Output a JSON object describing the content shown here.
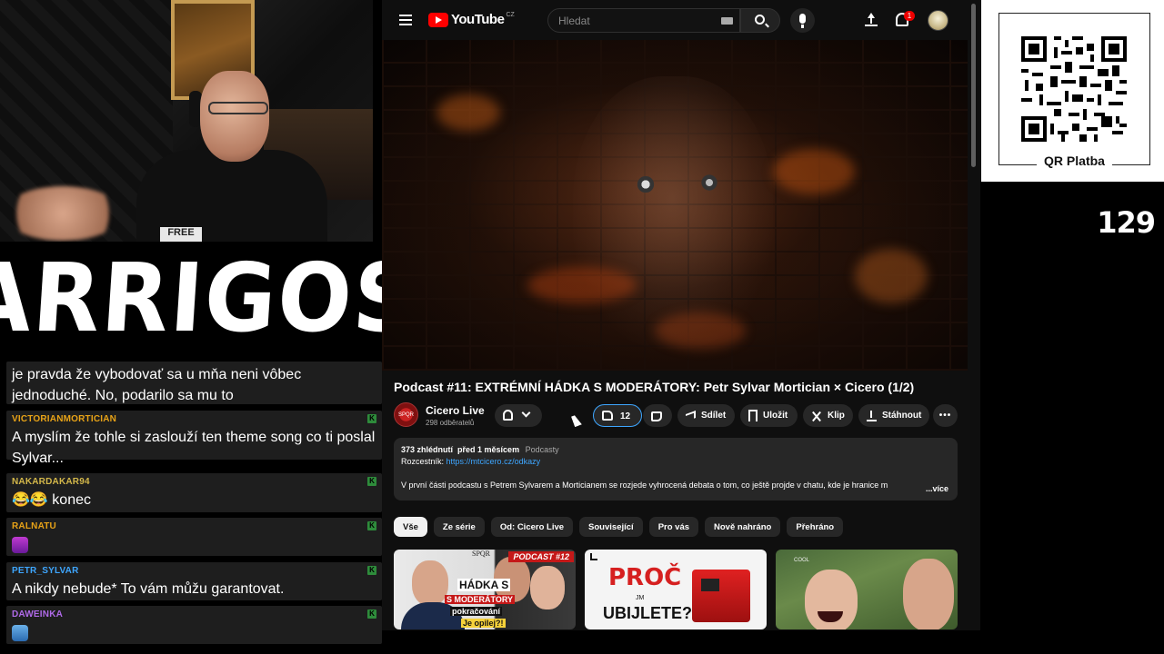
{
  "overlay": {
    "logo_text": "ARRIGOS",
    "viewer_count": "129",
    "qr_label": "QR Platba"
  },
  "chat": {
    "messages": [
      {
        "user": "",
        "text": "je pravda že vybodovať sa u mňa neni vôbec jednoduché. No, podarilo sa mu to",
        "user_color": "#ffffff"
      },
      {
        "user": "VICTORIANMORTICIAN",
        "text": "A myslím že tohle si zaslouží ten theme song co ti poslal Sylvar...",
        "user_color": "#e8a317"
      },
      {
        "user": "NAKARDAKAR94",
        "text": "😂😂 konec",
        "user_color": "#d4b84a"
      },
      {
        "user": "RALNATU",
        "text": "",
        "user_color": "#e8a317"
      },
      {
        "user": "PETR_SYLVAR",
        "text": "A nikdy nebude* To vám můžu garantovat.",
        "user_color": "#3ea6ff"
      },
      {
        "user": "DAWEINKA",
        "text": "",
        "user_color": "#b06ae8"
      }
    ]
  },
  "youtube": {
    "logo_text": "YouTube",
    "country_code": "CZ",
    "search_placeholder": "Hledat",
    "notification_count": "1",
    "video": {
      "title": "Podcast #11: EXTRÉMNÍ HÁDKA S MODERÁTORY: Petr Sylvar Mortician × Cicero (1/2)",
      "channel_name": "Cicero Live",
      "channel_avatar_text": "SPQR",
      "subscribers": "298 odběratelů",
      "like_count": "12",
      "share_label": "Sdílet",
      "save_label": "Uložit",
      "clip_label": "Klip",
      "download_label": "Stáhnout",
      "more_label": "•••"
    },
    "description": {
      "views": "373 zhlédnutí",
      "date": "před 1 měsícem",
      "tag": "Podcasty",
      "link_label": "Rozcestník:",
      "link_url": "https://mtcicero.cz/odkazy",
      "text": "V první části podcastu s Petrem Sylvarem a Morticianem se rozjede vyhrocená debata o tom, co ještě projde v chatu, kde je hranice m",
      "more_label": "...více"
    },
    "chips": [
      "Vše",
      "Ze série",
      "Od: Cicero Live",
      "Související",
      "Pro vás",
      "Nově nahráno",
      "Přehráno"
    ],
    "recommendations": [
      {
        "spqr": "SPQR",
        "badge": "PODCAST #12",
        "line1": "HÁDKA S",
        "line2": "S MODERÁTORY",
        "line3": "pokračování",
        "line4": "Je opilej?!"
      },
      {
        "line1": "PROČ",
        "line2": "UBIJLETE?",
        "jm": "JM"
      },
      {
        "mark": "COOL"
      }
    ]
  }
}
